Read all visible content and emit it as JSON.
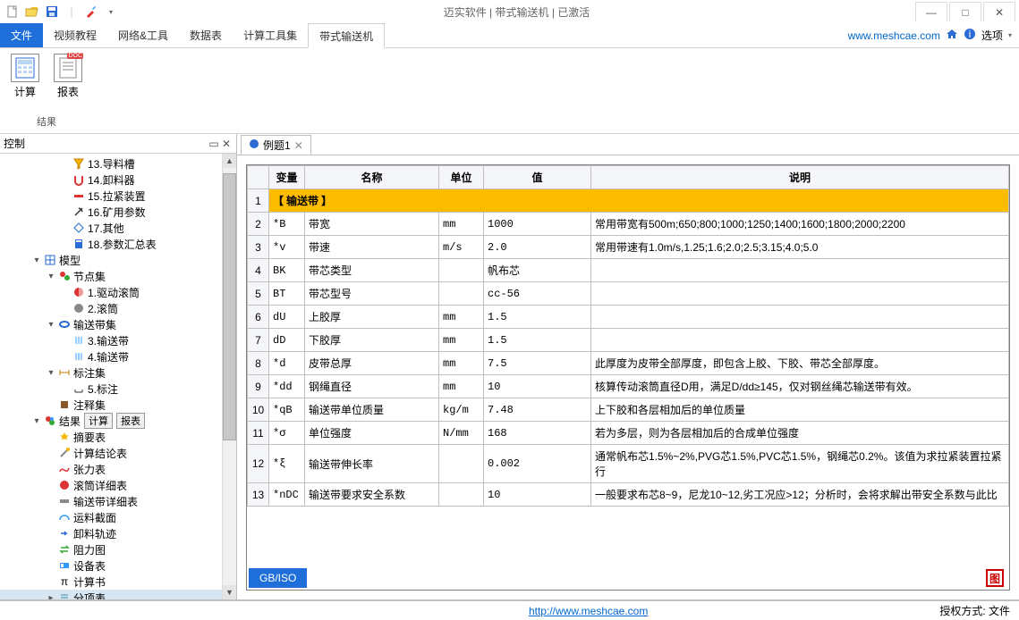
{
  "titlebar": {
    "title": "迈实软件 | 带式输送机 | 已激活"
  },
  "tabs": {
    "file": "文件",
    "items": [
      "视频教程",
      "网络&工具",
      "数据表",
      "计算工具集",
      "带式输送机"
    ],
    "active_index": 4,
    "right_link": "www.meshcae.com",
    "options": "选项"
  },
  "ribbon": {
    "group_name": "结果",
    "btn_calc": "计算",
    "btn_report": "报表",
    "doc_badge": "DOC"
  },
  "tree_panel": {
    "title": "控制"
  },
  "tree": [
    {
      "d": 3,
      "t": "",
      "i": "funnel",
      "x": "13.导料槽"
    },
    {
      "d": 3,
      "t": "",
      "i": "u",
      "x": "14.卸料器"
    },
    {
      "d": 3,
      "t": "",
      "i": "bar",
      "x": "15.拉紧装置"
    },
    {
      "d": 3,
      "t": "",
      "i": "pick",
      "x": "16.矿用参数"
    },
    {
      "d": 3,
      "t": "",
      "i": "diamond",
      "x": "17.其他"
    },
    {
      "d": 3,
      "t": "",
      "i": "book",
      "x": "18.参数汇总表"
    },
    {
      "d": 1,
      "t": "▾",
      "i": "grid",
      "x": "模型"
    },
    {
      "d": 2,
      "t": "▾",
      "i": "dots",
      "x": "节点集"
    },
    {
      "d": 3,
      "t": "",
      "i": "ball",
      "x": "1.驱动滚筒"
    },
    {
      "d": 3,
      "t": "",
      "i": "circle",
      "x": "2.滚筒"
    },
    {
      "d": 2,
      "t": "▾",
      "i": "belt",
      "x": "输送带集"
    },
    {
      "d": 3,
      "t": "",
      "i": "lines",
      "x": "3.输送带"
    },
    {
      "d": 3,
      "t": "",
      "i": "lines",
      "x": "4.输送带"
    },
    {
      "d": 2,
      "t": "▾",
      "i": "dim",
      "x": "标注集"
    },
    {
      "d": 3,
      "t": "",
      "i": "mark",
      "x": "5.标注"
    },
    {
      "d": 2,
      "t": "",
      "i": "note",
      "x": "注释集"
    },
    {
      "d": 1,
      "t": "▾",
      "i": "result",
      "x": "结果",
      "btns": [
        "计算",
        "报表"
      ]
    },
    {
      "d": 2,
      "t": "",
      "i": "star",
      "x": "摘要表"
    },
    {
      "d": 2,
      "t": "",
      "i": "wand",
      "x": "计算结论表"
    },
    {
      "d": 2,
      "t": "",
      "i": "curve",
      "x": "张力表"
    },
    {
      "d": 2,
      "t": "",
      "i": "reddisk",
      "x": "滚筒详细表"
    },
    {
      "d": 2,
      "t": "",
      "i": "greyblk",
      "x": "输送带详细表"
    },
    {
      "d": 2,
      "t": "",
      "i": "arc",
      "x": "运料截面"
    },
    {
      "d": 2,
      "t": "",
      "i": "arrow",
      "x": "卸料轨迹"
    },
    {
      "d": 2,
      "t": "",
      "i": "swap",
      "x": "阻力图"
    },
    {
      "d": 2,
      "t": "",
      "i": "device",
      "x": "设备表"
    },
    {
      "d": 2,
      "t": "",
      "i": "pi",
      "x": "计算书"
    },
    {
      "d": 2,
      "t": "▸",
      "i": "stack",
      "x": "分项表",
      "sel": true
    }
  ],
  "doc_tab": {
    "label": "例题1"
  },
  "table": {
    "headers": [
      "",
      "变量",
      "名称",
      "单位",
      "值",
      "说明"
    ],
    "rows": [
      {
        "n": "1",
        "section": "【 输送带 】"
      },
      {
        "n": "2",
        "v": "*B",
        "name": "带宽",
        "u": "mm",
        "val": "1000",
        "desc": "常用带宽有500m;650;800;1000;1250;1400;1600;1800;2000;2200"
      },
      {
        "n": "3",
        "v": "*v",
        "name": "带速",
        "u": "m/s",
        "val": "2.0",
        "desc": "常用带速有1.0m/s,1.25;1.6;2.0;2.5;3.15;4.0;5.0"
      },
      {
        "n": "4",
        "v": "BK",
        "name": "带芯类型",
        "u": "",
        "val": "帆布芯",
        "desc": ""
      },
      {
        "n": "5",
        "v": "BT",
        "name": "带芯型号",
        "u": "",
        "val": "cc-56",
        "desc": ""
      },
      {
        "n": "6",
        "v": "dU",
        "name": "上胶厚",
        "u": "mm",
        "val": "1.5",
        "desc": ""
      },
      {
        "n": "7",
        "v": "dD",
        "name": "下胶厚",
        "u": "mm",
        "val": "1.5",
        "desc": ""
      },
      {
        "n": "8",
        "v": "*d",
        "name": "皮带总厚",
        "u": "mm",
        "val": "7.5",
        "desc": "此厚度为皮带全部厚度，即包含上胶、下胶、带芯全部厚度。"
      },
      {
        "n": "9",
        "v": "*dd",
        "name": "钢绳直径",
        "u": "mm",
        "val": "10",
        "desc": "核算传动滚筒直径D用，满足D/dd≥145，仅对钢丝绳芯输送带有效。"
      },
      {
        "n": "10",
        "v": "*qB",
        "name": "输送带单位质量",
        "u": "kg/m",
        "val": "7.48",
        "desc": "上下胶和各层相加后的单位质量"
      },
      {
        "n": "11",
        "v": "*σ",
        "name": "单位强度",
        "u": "N/mm",
        "val": "168",
        "desc": "若为多层，则为各层相加后的合成单位强度"
      },
      {
        "n": "12",
        "v": "*ξ",
        "name": "输送带伸长率",
        "u": "",
        "val": "0.002",
        "desc": "通常帆布芯1.5%~2%,PVG芯1.5%,PVC芯1.5%，钢绳芯0.2%。该值为求拉紧装置拉紧行"
      },
      {
        "n": "13",
        "v": "*nDC",
        "name": "输送带要求安全系数",
        "u": "",
        "val": "10",
        "desc": "一般要求布芯8~9，尼龙10~12,劣工况应>12；分析时，会将求解出带安全系数与此比"
      }
    ]
  },
  "bottom_button": "GB/ISO",
  "bottom_icon": "图",
  "status": {
    "link": "http://www.meshcae.com",
    "auth": "授权方式: 文件"
  }
}
